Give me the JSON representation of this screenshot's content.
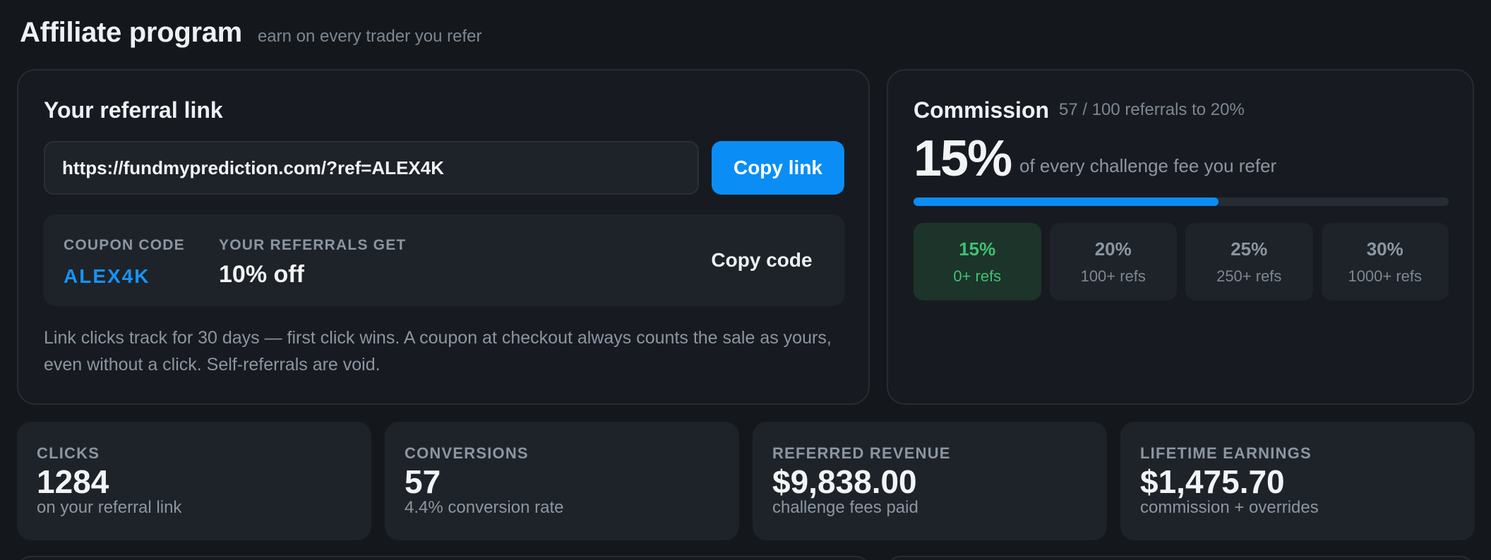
{
  "header": {
    "title": "Affiliate program",
    "subtitle": "earn on every trader you refer"
  },
  "referral": {
    "title": "Your referral link",
    "link_value": "https://fundmyprediction.com/?ref=ALEX4K",
    "copy_link_label": "Copy link",
    "coupon_label": "COUPON CODE",
    "coupon_code": "ALEX4K",
    "get_label": "YOUR REFERRALS GET",
    "get_value": "10% off",
    "copy_code_label": "Copy code",
    "note": "Link clicks track for 30 days — first click wins. A coupon at checkout always counts the sale as yours, even without a click. Self-referrals are void."
  },
  "commission": {
    "title": "Commission",
    "progress_text": "57 / 100 referrals to 20%",
    "rate": "15%",
    "description": "of every challenge fee you refer",
    "progress_fraction": 0.57,
    "tiers": [
      {
        "rate": "15%",
        "refs": "0+ refs",
        "active": true
      },
      {
        "rate": "20%",
        "refs": "100+ refs",
        "active": false
      },
      {
        "rate": "25%",
        "refs": "250+ refs",
        "active": false
      },
      {
        "rate": "30%",
        "refs": "1000+ refs",
        "active": false
      }
    ]
  },
  "stats": [
    {
      "label": "CLICKS",
      "value": "1284",
      "sub": "on your referral link"
    },
    {
      "label": "CONVERSIONS",
      "value": "57",
      "sub": "4.4% conversion rate"
    },
    {
      "label": "REFERRED REVENUE",
      "value": "$9,838.00",
      "sub": "challenge fees paid"
    },
    {
      "label": "LIFETIME EARNINGS",
      "value": "$1,475.70",
      "sub": "commission + overrides"
    }
  ],
  "colors": {
    "accent": "#0a8ef5",
    "success": "#3fc173",
    "background": "#14181d",
    "card": "#171b21"
  }
}
